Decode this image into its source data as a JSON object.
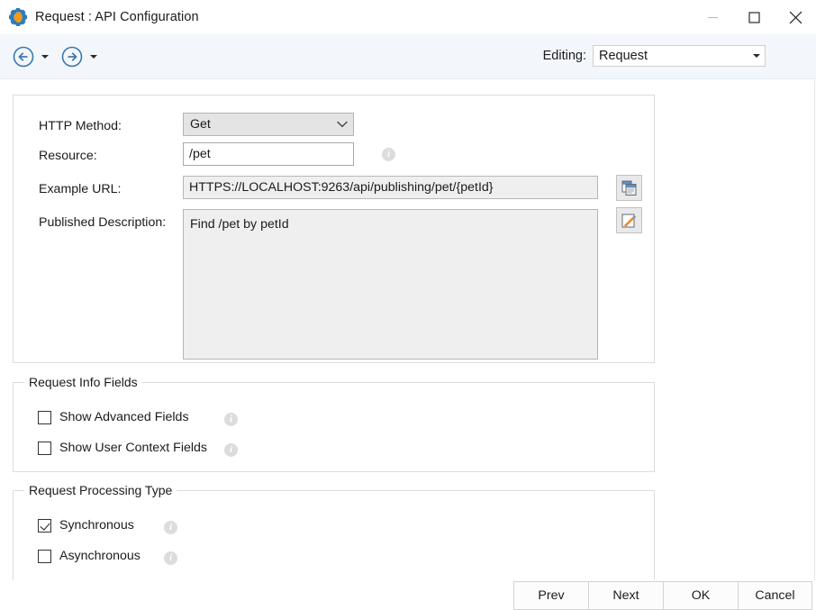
{
  "window": {
    "title": "Request : API Configuration",
    "icon": "gear-icon",
    "controls": {
      "minimize": "minimize-icon",
      "maximize": "maximize-icon",
      "close": "close-icon"
    }
  },
  "toolbar": {
    "back": "back-arrow-icon",
    "back_dropdown": "chevron-down-icon",
    "forward": "forward-arrow-icon",
    "forward_dropdown": "chevron-down-icon",
    "editing_label": "Editing:",
    "editing_value": "Request",
    "editing_dropdown": "chevron-down-icon"
  },
  "form": {
    "http_method": {
      "label": "HTTP Method:",
      "value": "Get"
    },
    "resource": {
      "label": "Resource:",
      "value": "/pet",
      "info": "info-icon"
    },
    "example_url": {
      "label": "Example URL:",
      "value": "HTTPS://LOCALHOST:9263/api/publishing/pet/{petId}",
      "copy_button": "copy-icon"
    },
    "published_description": {
      "label": "Published Description:",
      "value": "Find /pet by petId",
      "edit_button": "edit-pencil-icon"
    }
  },
  "request_info_fields": {
    "title": "Request Info Fields",
    "checkboxes": [
      {
        "label": "Show Advanced Fields",
        "checked": false,
        "info": "info-icon"
      },
      {
        "label": "Show User Context Fields",
        "checked": false,
        "info": "info-icon"
      }
    ]
  },
  "request_processing_type": {
    "title": "Request Processing Type",
    "checkboxes": [
      {
        "label": "Synchronous",
        "checked": true,
        "info": "info-icon"
      },
      {
        "label": "Asynchronous",
        "checked": false,
        "info": "info-icon"
      }
    ]
  },
  "footer": {
    "prev": "Prev",
    "next": "Next",
    "ok": "OK",
    "cancel": "Cancel"
  },
  "colors": {
    "toolbar_bg": "#f3f7fb",
    "accent_blue": "#2c7bbd",
    "accent_orange": "#f09a1e",
    "readonly_bg": "#efefef"
  }
}
